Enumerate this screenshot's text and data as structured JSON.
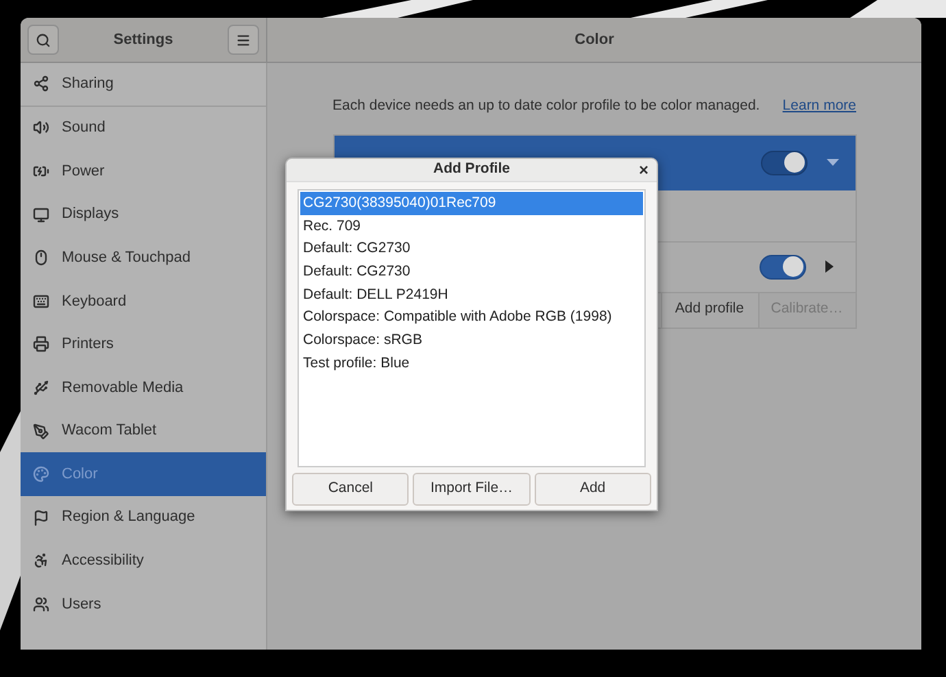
{
  "window": {
    "sidebar_title": "Settings",
    "content_title": "Color"
  },
  "sidebar": {
    "items": [
      {
        "label": "Sharing",
        "selected": false
      },
      {
        "label": "Sound",
        "selected": false
      },
      {
        "label": "Power",
        "selected": false
      },
      {
        "label": "Displays",
        "selected": false
      },
      {
        "label": "Mouse & Touchpad",
        "selected": false
      },
      {
        "label": "Keyboard",
        "selected": false
      },
      {
        "label": "Printers",
        "selected": false
      },
      {
        "label": "Removable Media",
        "selected": false
      },
      {
        "label": "Wacom Tablet",
        "selected": false
      },
      {
        "label": "Color",
        "selected": true
      },
      {
        "label": "Region & Language",
        "selected": false
      },
      {
        "label": "Accessibility",
        "selected": false
      },
      {
        "label": "Users",
        "selected": false
      }
    ]
  },
  "content": {
    "description": "Each device needs an up to date color profile to be color managed.",
    "learn_more": "Learn more",
    "device": {
      "on": true,
      "expanded": true
    },
    "profile_row": {
      "on": true
    },
    "buttons": [
      {
        "label": "Add profile",
        "disabled": false
      },
      {
        "label": "Calibrate…",
        "disabled": true
      }
    ]
  },
  "dialog": {
    "title": "Add Profile",
    "close": "×",
    "profiles": [
      {
        "label": "CG2730(38395040)01Rec709",
        "selected": true
      },
      {
        "label": "Rec. 709",
        "selected": false
      },
      {
        "label": "Default: CG2730",
        "selected": false
      },
      {
        "label": "Default: CG2730",
        "selected": false
      },
      {
        "label": "Default: DELL P2419H",
        "selected": false
      },
      {
        "label": "Colorspace: Compatible with Adobe RGB (1998)",
        "selected": false
      },
      {
        "label": "Colorspace: sRGB",
        "selected": false
      },
      {
        "label": "Test profile: Blue",
        "selected": false
      }
    ],
    "buttons": [
      "Cancel",
      "Import File…",
      "Add"
    ]
  }
}
